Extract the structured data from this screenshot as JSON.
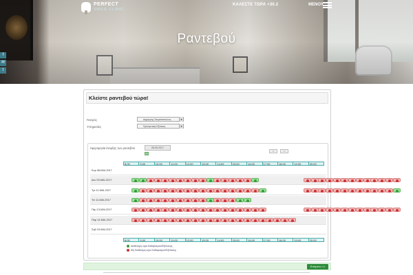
{
  "header": {
    "logo_line1": "PERFECT",
    "logo_line2": "SMILE CLINIC",
    "call_label": "ΚΑΛΕΣΤΕ ΤΩΡΑ +30.2",
    "menu_label": "ΜΕΝΟΥ",
    "page_title": "Ραντεβού"
  },
  "social": [
    "f",
    "✉",
    "t"
  ],
  "panel": {
    "title": "Κλείστε ραντεβού τώρα!",
    "doctor_label": "Γιατρός",
    "doctor_value": "Δημήτρης Σταματόπουλος",
    "service_label": "Υπηρεσίες",
    "service_value": "Προληπτική Εξέταση",
    "date_label": "Ημερομηνία έναρξης των ραντεβού",
    "date_value": "08-05-2017",
    "prev_label": "<<",
    "next_label": ">>",
    "hours": [
      "8:00",
      "9:00",
      "10:00",
      "11:00",
      "12:00",
      "13:00",
      "14:00",
      "15:00",
      "16:00",
      "17:00",
      "18:00",
      "19:00",
      "20:00"
    ],
    "days": [
      {
        "label": "Κυρ 08-ΜΑΙ-2017",
        "shade": false,
        "slots": ""
      },
      {
        "label": "Δευ 09-ΜΑΙ-2017",
        "shade": true,
        "slots": "ggrrrrrrrrgrrrrrg......rrrrrrrrrrrrr"
      },
      {
        "label": "Τρι 11-ΜΑΙ-2017",
        "shade": false,
        "slots": "grrrrrrrrrrrrrrrrg.....rrrrrrrrrrrrg"
      },
      {
        "label": "Τετ 11-ΜΑΙ-2017",
        "shade": true,
        "slots": "grrrrrrrrrgrrrgg"
      },
      {
        "label": "Πεμ 13-ΜΑΙ-2017",
        "shade": false,
        "slots": "rrrrrrrrrrrrrrrrrr.....rrrrrrrrrrrrr"
      },
      {
        "label": "Παρ 14-ΜΑΙ-2017",
        "shade": true,
        "slots": "rrrrrrrrrrrrrrrrrrrrrr"
      },
      {
        "label": "Σαβ 15-ΜΑΙ-2017",
        "shade": false,
        "slots": ""
      }
    ],
    "legend_available": "Διαθέσιμη ώρα Καθαρισμού/Εξέτασης",
    "legend_unavailable": "Μη διαθέσιμη ώρα Καθαρισμού/Εξέτασης",
    "next_button": "Επόμενο >>"
  },
  "colors": {
    "accent": "#2e8b3a",
    "available": "#9ee39e",
    "unavailable": "#f4b8b8",
    "social": "#3d7b8a"
  }
}
